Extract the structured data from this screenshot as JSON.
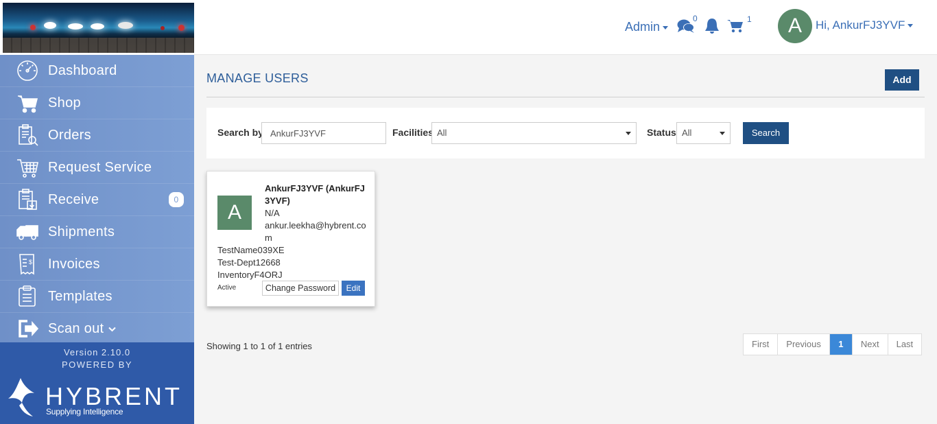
{
  "header": {
    "admin_label": "Admin",
    "messages_count": "0",
    "cart_count": "1",
    "user_initial": "A",
    "user_greeting": "Hi, AnkurFJ3YVF"
  },
  "sidebar": {
    "items": [
      {
        "label": "Dashboard",
        "icon": "dashboard-icon"
      },
      {
        "label": "Shop",
        "icon": "cart-icon"
      },
      {
        "label": "Orders",
        "icon": "orders-icon"
      },
      {
        "label": "Request Service",
        "icon": "request-service-icon"
      },
      {
        "label": "Receive",
        "icon": "receive-icon",
        "badge": "0"
      },
      {
        "label": "Shipments",
        "icon": "truck-icon"
      },
      {
        "label": "Invoices",
        "icon": "invoice-icon"
      },
      {
        "label": "Templates",
        "icon": "templates-icon"
      },
      {
        "label": "Scan out",
        "icon": "scan-out-icon"
      }
    ],
    "version": "Version 2.10.0",
    "powered_by": "POWERED BY",
    "brand": "HYBRENT",
    "tagline": "Supplying Intelligence"
  },
  "main": {
    "title": "MANAGE USERS",
    "add_label": "Add",
    "search": {
      "search_by_label": "Search by",
      "search_value": "AnkurFJ3YVF",
      "facilities_label": "Facilities",
      "facilities_value": "All",
      "status_label": "Status",
      "status_value": "All",
      "search_button": "Search"
    },
    "user_card": {
      "initial": "A",
      "name": "AnkurFJ3YVF (AnkurFJ3YVF)",
      "phone": "N/A",
      "email": "ankur.leekha@hybrent.com",
      "facility": "TestName039XE",
      "department": "Test-Dept12668",
      "inventory": "InventoryF4ORJ",
      "status": "Active",
      "change_password_label": "Change Password",
      "edit_label": "Edit"
    },
    "entries_text": "Showing 1 to 1 of 1 entries",
    "pagination": {
      "first": "First",
      "previous": "Previous",
      "current": "1",
      "next": "Next",
      "last": "Last"
    }
  },
  "colors": {
    "sidebar": "#7a9bd0",
    "footer": "#2f5aa8",
    "primary_button": "#1f4f83",
    "link": "#3b6fb6",
    "avatar": "#5a8a6a"
  }
}
